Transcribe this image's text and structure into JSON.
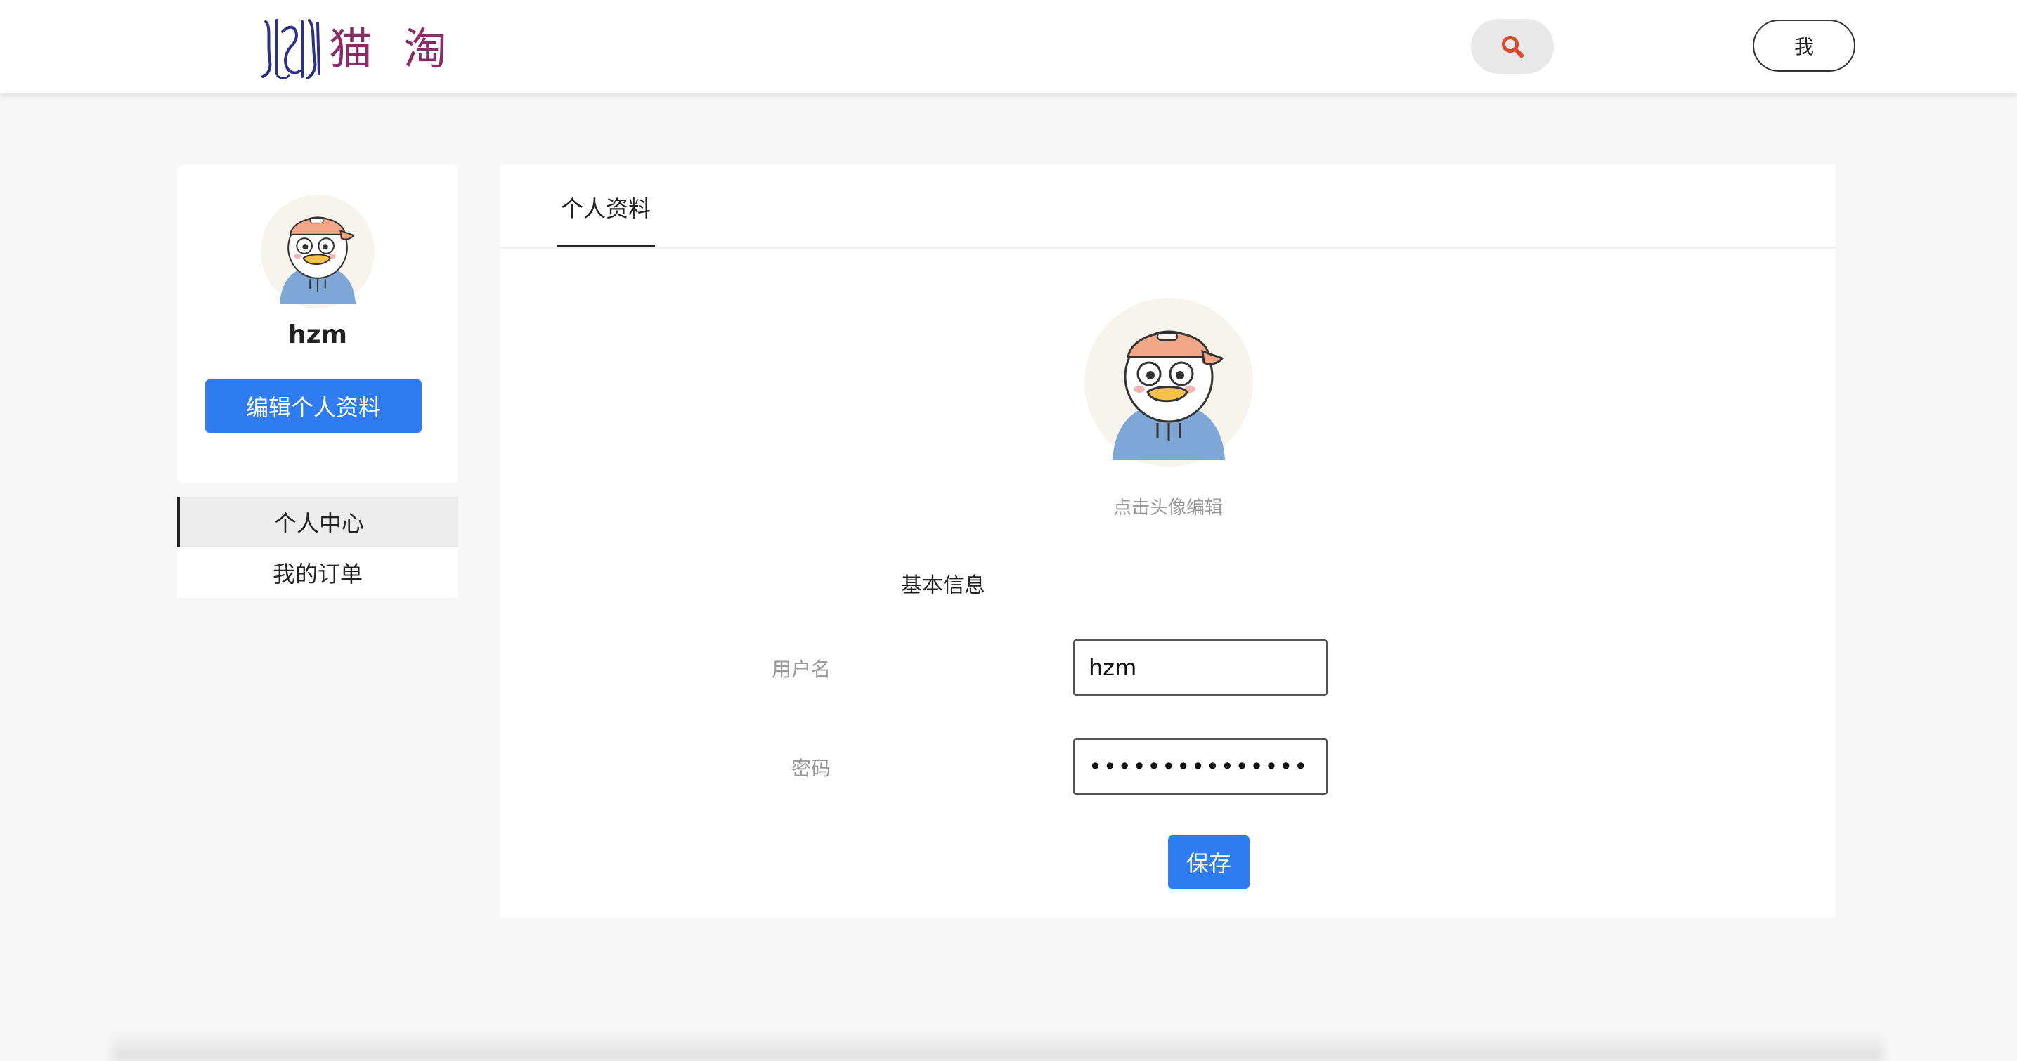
{
  "header": {
    "logo_text": "猫淘",
    "logo_mark": "JIC",
    "search_icon": "search-icon",
    "me_label": "我"
  },
  "sidebar": {
    "username": "hzm",
    "edit_profile_label": "编辑个人资料",
    "nav": [
      {
        "label": "个人中心",
        "active": true
      },
      {
        "label": "我的订单",
        "active": false
      }
    ]
  },
  "main": {
    "tab_label": "个人资料",
    "avatar_hint": "点击头像编辑",
    "section_title": "基本信息",
    "fields": {
      "username_label": "用户名",
      "username_value": "hzm",
      "password_label": "密码",
      "password_value": "••••••••••••••••••••••"
    },
    "save_label": "保存"
  },
  "colors": {
    "primary": "#2f7cf0",
    "brand": "#8a2d66",
    "search_icon": "#d9482b",
    "page_bg": "#f6f6f6"
  }
}
